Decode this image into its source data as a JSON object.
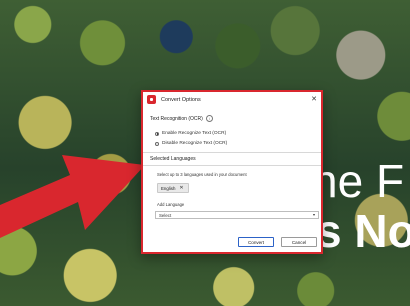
{
  "background": {
    "headline_line1": "he F",
    "headline_line2": "s No"
  },
  "dialog": {
    "title": "Convert Options",
    "close_glyph": "✕",
    "ocr": {
      "label": "Text Recognition (OCR)",
      "info_glyph": "i",
      "options": [
        {
          "label": "Enable Recognize Text (OCR)",
          "checked": true
        },
        {
          "label": "Disable Recognize Text (OCR)",
          "checked": false
        }
      ]
    },
    "languages": {
      "label": "Selected Languages",
      "note": "Select up to 3 languages used in your document",
      "selected": [
        "English"
      ],
      "remove_glyph": "✕"
    },
    "add_language": {
      "label": "Add Language",
      "value": "Select"
    },
    "buttons": {
      "convert": "Convert",
      "cancel": "Cancel"
    }
  },
  "colors": {
    "accent": "#d9272e",
    "primary_button_border": "#2c62c7"
  }
}
